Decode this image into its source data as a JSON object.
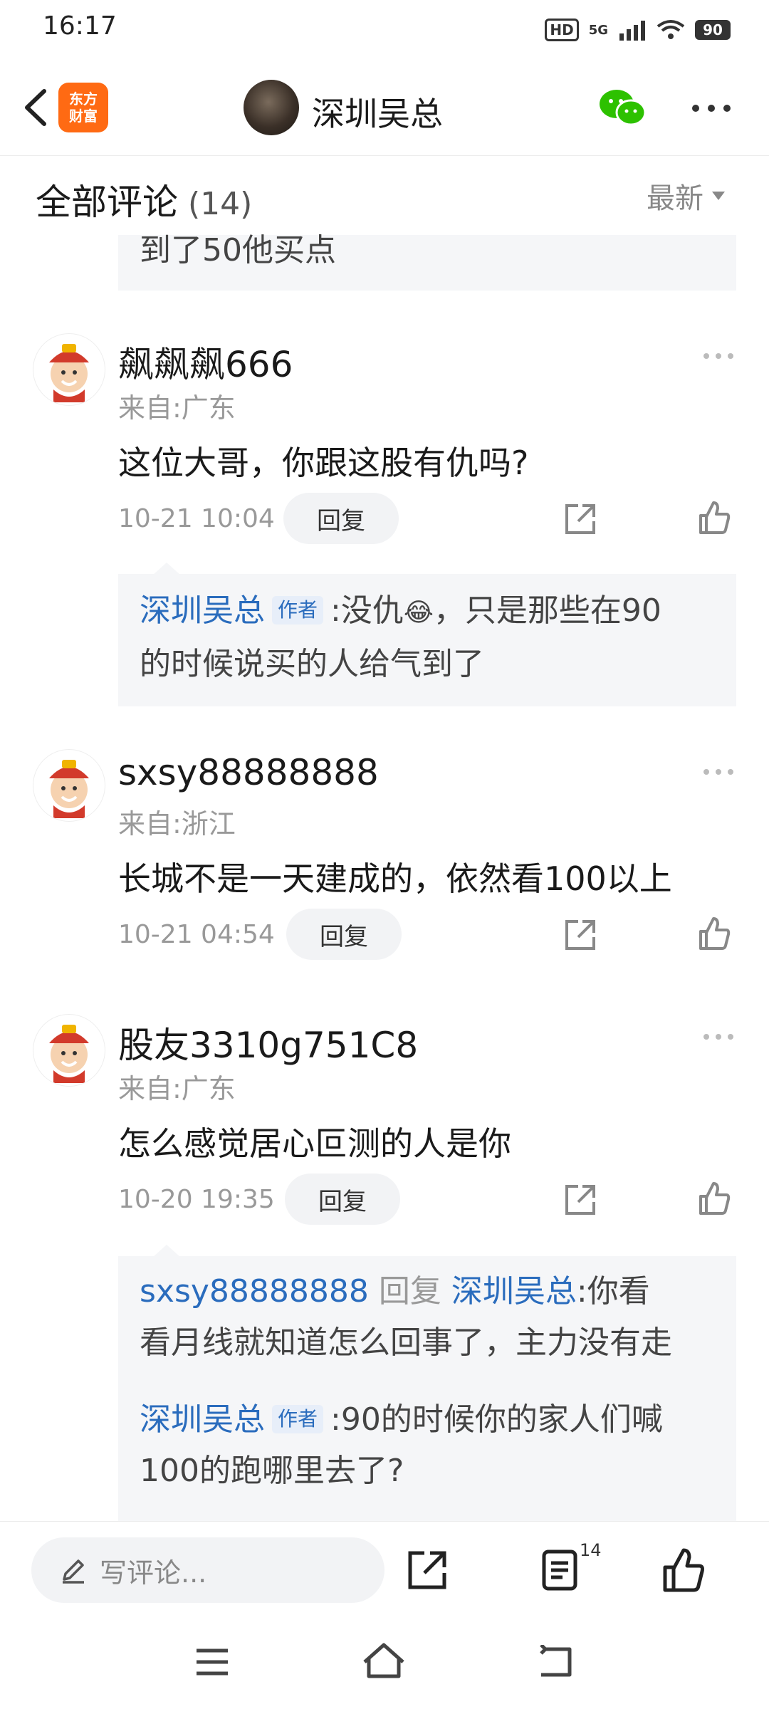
{
  "status": {
    "time": "16:17",
    "hd": "HD",
    "net": "5G",
    "battery": "90"
  },
  "header": {
    "logo_line1": "东方",
    "logo_line2": "财富",
    "title": "深圳吴总"
  },
  "section": {
    "title": "全部评论",
    "count": "(14)",
    "sort": "最新"
  },
  "top_reply": {
    "text": "到了50他买点"
  },
  "comments": [
    {
      "user": "飙飙飙666",
      "from": "来自:广东",
      "text": "这位大哥，你跟这股有仇吗?",
      "date": "10-21 10:04",
      "reply_label": "回复",
      "replies": [
        {
          "user": "深圳吴总",
          "tag": "作者",
          "text_a": ":没仇",
          "emoji": "😂",
          "text_b": "，只是那些在90",
          "text_c": "的时候说买的人给气到了"
        }
      ]
    },
    {
      "user": "sxsy88888888",
      "from": "来自:浙江",
      "text": "长城不是一天建成的，依然看100以上",
      "date": "10-21 04:54",
      "reply_label": "回复"
    },
    {
      "user": "股友3310g751C8",
      "from": "来自:广东",
      "text": "怎么感觉居心叵测的人是你",
      "date": "10-20 19:35",
      "reply_label": "回复",
      "replies": [
        {
          "user": "sxsy88888888",
          "reply_word": "回复",
          "target": "深圳吴总",
          "text_a": ":你看",
          "text_b": "看月线就知道怎么回事了，主力没有走"
        },
        {
          "user": "深圳吴总",
          "tag": "作者",
          "text_a": ":90的时候你的家人们喊",
          "text_b": "100的跑哪里去了?"
        }
      ]
    }
  ],
  "bottom": {
    "placeholder": "写评论...",
    "comment_count": "14"
  }
}
